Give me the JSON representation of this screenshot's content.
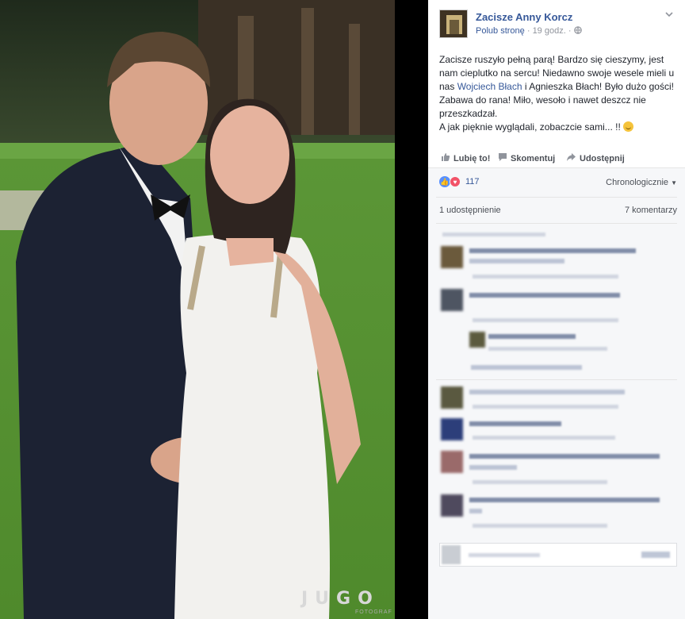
{
  "photo": {
    "watermark": "JUGO",
    "watermark_sub": "FOTOGRAF"
  },
  "post": {
    "page_name": "Zacisze Anny Korcz",
    "like_page": "Polub stronę",
    "time": "19 godz.",
    "text_before_mention": "Zacisze ruszyło pełną parą! Bardzo się cieszymy, jest nam cieplutko na sercu! Niedawno swoje wesele mieli u nas ",
    "mention": "Wojciech Błach",
    "text_after_mention": " i Agnieszka Błach! Było dużo gości! Zabawa do rana! Miło, wesoło i nawet deszcz nie przeszkadzał.",
    "text_line2": "A jak pięknie wyglądali, zobaczcie sami... !! ",
    "actions": {
      "like": "Lubię to!",
      "comment": "Skomentuj",
      "share": "Udostępnij"
    },
    "reaction_count": "117",
    "sort_label": "Chronologicznie",
    "share_count": "1 udostępnienie",
    "comment_count": "7 komentarzy"
  },
  "colors": {
    "link": "#365899",
    "text": "#1d2129",
    "meta": "#90949c",
    "ufi_bg": "#f6f7f9",
    "like_blue": "#5890ff",
    "love_red": "#f25268"
  },
  "icons": {
    "like": "thumbs-up-icon",
    "comment": "speech-bubble-icon",
    "share": "share-arrow-icon",
    "globe": "globe-icon",
    "chevron": "chevron-down-icon"
  }
}
